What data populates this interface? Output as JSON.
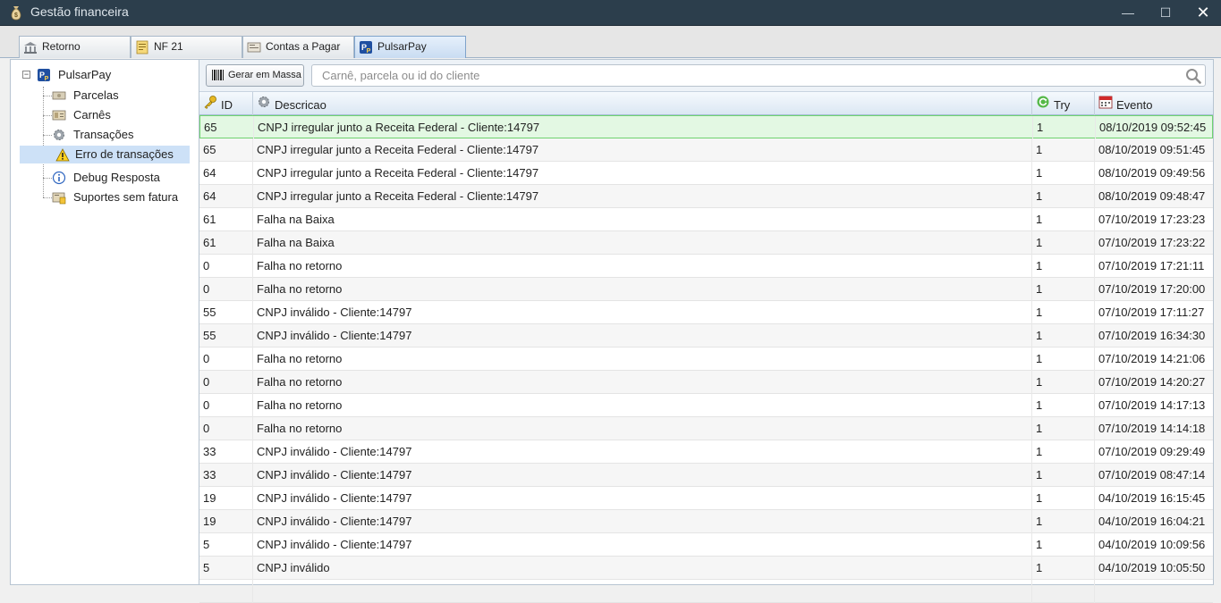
{
  "window": {
    "title": "Gestão financeira",
    "app_icon": "money-bag-icon",
    "minimize_glyph": "—",
    "maximize_glyph": "☐",
    "close_glyph": "✕"
  },
  "tabs": [
    {
      "label": "Retorno",
      "icon": "bank-icon"
    },
    {
      "label": "NF 21",
      "icon": "invoice-icon"
    },
    {
      "label": "Contas a Pagar",
      "icon": "bill-icon"
    },
    {
      "label": "PulsarPay",
      "icon": "pulsarpay-logo-icon",
      "active": true
    }
  ],
  "tree": {
    "root": {
      "label": "PulsarPay",
      "expander": "−"
    },
    "items": [
      {
        "label": "Parcelas",
        "icon": "cash-icon"
      },
      {
        "label": "Carnês",
        "icon": "booklet-icon"
      },
      {
        "label": "Transações",
        "icon": "gear-icon"
      },
      {
        "label": "Erro de transações",
        "icon": "warning-icon",
        "selected": true
      },
      {
        "label": "Debug Resposta",
        "icon": "info-icon"
      },
      {
        "label": "Suportes sem fatura",
        "icon": "receipt-icon"
      }
    ]
  },
  "toolbar": {
    "generate_label": "Gerar em Massa",
    "generate_icon": "barcode-icon",
    "search_placeholder": "Carnê, parcela ou id do cliente",
    "search_value": ""
  },
  "grid": {
    "columns": [
      {
        "label": "ID",
        "icon": "key-icon"
      },
      {
        "label": "Descricao",
        "icon": "gear-icon"
      },
      {
        "label": "Try",
        "icon": "retry-icon"
      },
      {
        "label": "Evento",
        "icon": "calendar-icon"
      }
    ],
    "rows": [
      {
        "id": "65",
        "desc": "CNPJ irregular junto a Receita Federal - Cliente:14797",
        "try": "1",
        "evento": "08/10/2019 09:52:45"
      },
      {
        "id": "65",
        "desc": "CNPJ irregular junto a Receita Federal - Cliente:14797",
        "try": "1",
        "evento": "08/10/2019 09:51:45"
      },
      {
        "id": "64",
        "desc": "CNPJ irregular junto a Receita Federal - Cliente:14797",
        "try": "1",
        "evento": "08/10/2019 09:49:56"
      },
      {
        "id": "64",
        "desc": "CNPJ irregular junto a Receita Federal - Cliente:14797",
        "try": "1",
        "evento": "08/10/2019 09:48:47"
      },
      {
        "id": "61",
        "desc": "Falha na Baixa",
        "try": "1",
        "evento": "07/10/2019 17:23:23"
      },
      {
        "id": "61",
        "desc": "Falha na Baixa",
        "try": "1",
        "evento": "07/10/2019 17:23:22"
      },
      {
        "id": "0",
        "desc": "Falha no retorno",
        "try": "1",
        "evento": "07/10/2019 17:21:11"
      },
      {
        "id": "0",
        "desc": "Falha no retorno",
        "try": "1",
        "evento": "07/10/2019 17:20:00"
      },
      {
        "id": "55",
        "desc": "CNPJ inválido - Cliente:14797",
        "try": "1",
        "evento": "07/10/2019 17:11:27"
      },
      {
        "id": "55",
        "desc": "CNPJ inválido - Cliente:14797",
        "try": "1",
        "evento": "07/10/2019 16:34:30"
      },
      {
        "id": "0",
        "desc": "Falha no retorno",
        "try": "1",
        "evento": "07/10/2019 14:21:06"
      },
      {
        "id": "0",
        "desc": "Falha no retorno",
        "try": "1",
        "evento": "07/10/2019 14:20:27"
      },
      {
        "id": "0",
        "desc": "Falha no retorno",
        "try": "1",
        "evento": "07/10/2019 14:17:13"
      },
      {
        "id": "0",
        "desc": "Falha no retorno",
        "try": "1",
        "evento": "07/10/2019 14:14:18"
      },
      {
        "id": "33",
        "desc": "CNPJ inválido - Cliente:14797",
        "try": "1",
        "evento": "07/10/2019 09:29:49"
      },
      {
        "id": "33",
        "desc": "CNPJ inválido - Cliente:14797",
        "try": "1",
        "evento": "07/10/2019 08:47:14"
      },
      {
        "id": "19",
        "desc": "CNPJ inválido - Cliente:14797",
        "try": "1",
        "evento": "04/10/2019 16:15:45"
      },
      {
        "id": "19",
        "desc": "CNPJ inválido - Cliente:14797",
        "try": "1",
        "evento": "04/10/2019 16:04:21"
      },
      {
        "id": "5",
        "desc": "CNPJ inválido - Cliente:14797",
        "try": "1",
        "evento": "04/10/2019 10:09:56"
      },
      {
        "id": "5",
        "desc": "CNPJ inválido",
        "try": "1",
        "evento": "04/10/2019 10:05:50"
      },
      {
        "id": "",
        "desc": "",
        "try": "",
        "evento": ""
      }
    ]
  },
  "colors": {
    "titlebar": "#2c3e4c",
    "selection": "#cde1f7",
    "row_highlight": "#e3f8e3",
    "row_highlight_border": "#6fd36f"
  }
}
